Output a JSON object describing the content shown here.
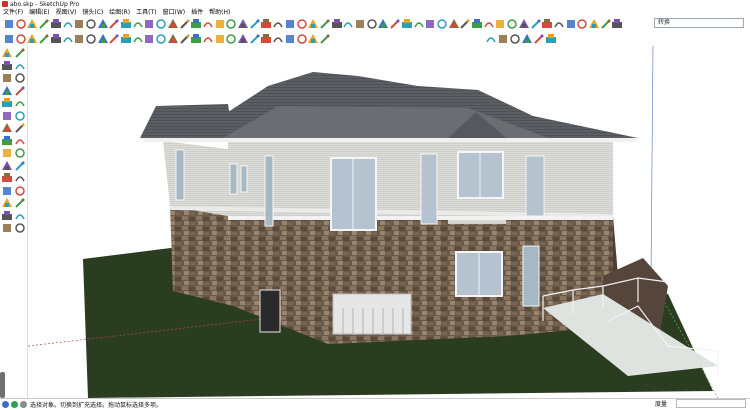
{
  "window": {
    "title": "abo.skp - SketchUp Pro"
  },
  "menu": [
    "文件(F)",
    "编辑(E)",
    "视图(V)",
    "镜头(C)",
    "绘图(R)",
    "工具(T)",
    "窗口(W)",
    "插件",
    "帮助(H)"
  ],
  "search": {
    "value": "转换"
  },
  "status": {
    "message": "选择对象。切换到扩充选择。拖动鼠标选择多项。",
    "measure_label": "度量"
  },
  "icons": {
    "main_toolbar": [
      "select-icon",
      "pencil-icon",
      "rectangle-icon",
      "circle-icon",
      "arc-icon",
      "polygon-icon",
      "freehand-icon",
      "eraser-icon",
      "paint-bucket-icon",
      "push-pull-icon",
      "move-icon",
      "rotate-icon",
      "scale-icon",
      "offset-icon",
      "follow-me-icon",
      "tape-measure-icon",
      "protractor-icon",
      "dimension-icon",
      "text-icon",
      "axes-icon",
      "section-plane-icon",
      "orbit-icon",
      "pan-icon",
      "zoom-icon",
      "zoom-window-icon",
      "zoom-extents-icon",
      "previous-view-icon",
      "next-view-icon",
      "walk-icon",
      "look-around-icon",
      "position-camera-icon",
      "components-icon",
      "materials-icon",
      "styles-icon",
      "layers-icon",
      "scenes-icon",
      "shadows-icon",
      "fog-icon",
      "soften-edges-icon",
      "outliner-icon",
      "entity-info-icon",
      "new-file-icon",
      "open-file-icon",
      "save-icon",
      "cut-icon",
      "copy-icon",
      "paste-icon",
      "erase-icon",
      "undo-icon",
      "redo-icon",
      "print-icon",
      "model-info-icon",
      "user-icon"
    ],
    "secondary_toolbar": [
      "sandbox-icon",
      "geo-icon",
      "terrain-icon",
      "solid-union-icon",
      "solid-subtract-icon",
      "solid-trim-icon",
      "solid-intersect-icon",
      "split-icon",
      "outer-shell-icon",
      "xray-icon",
      "back-edges-icon",
      "wireframe-icon",
      "hidden-line-icon",
      "shaded-icon",
      "shaded-texture-icon",
      "monochrome-icon",
      "iso-view-icon",
      "top-view-icon",
      "front-view-icon",
      "right-view-icon",
      "back-view-icon",
      "left-view-icon",
      "bottom-view-icon",
      "perspective-icon",
      "two-point-icon",
      "parallel-icon",
      "camera-icon",
      "flythrough-icon",
      "section-cut-icon",
      "section-display-icon",
      "ruby-console-icon",
      "extension-icon",
      "warehouse-icon",
      "sketchup-icon"
    ],
    "left_toolbar": [
      "select-icon",
      "eraser-icon",
      "line-icon",
      "freehand-icon",
      "rectangle-icon",
      "rotated-rect-icon",
      "circle-icon",
      "polygon-icon",
      "arc-icon",
      "pie-icon",
      "move-icon",
      "push-pull-icon",
      "rotate-icon",
      "follow-me-icon",
      "scale-icon",
      "offset-icon",
      "tape-measure-icon",
      "dimension-icon",
      "protractor-icon",
      "text-icon",
      "axes-icon",
      "3d-text-icon",
      "orbit-icon",
      "pan-icon",
      "zoom-icon",
      "zoom-extents-icon",
      "walk-icon",
      "position-icon",
      "section-icon",
      "look-icon"
    ]
  }
}
